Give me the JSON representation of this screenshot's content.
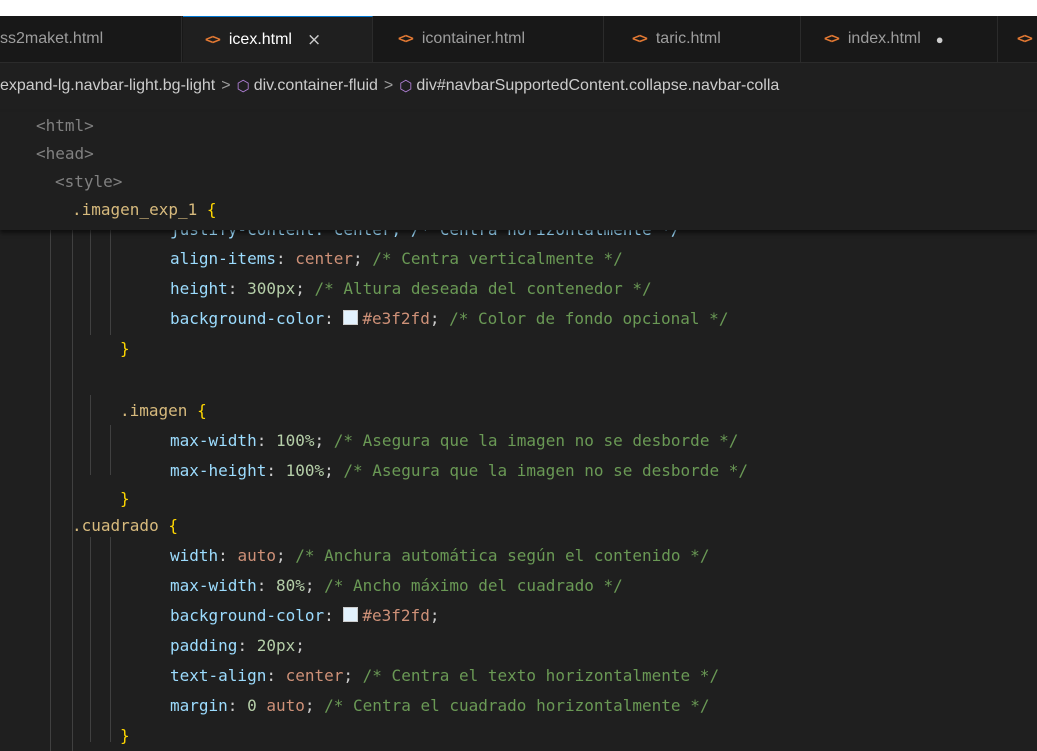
{
  "tabs": [
    {
      "label": "ss2maket.html",
      "icon": "<>",
      "active": false
    },
    {
      "label": "icex.html",
      "icon": "<>",
      "active": true,
      "close": "×"
    },
    {
      "label": "icontainer.html",
      "icon": "<>",
      "active": false
    },
    {
      "label": "taric.html",
      "icon": "<>",
      "active": false
    },
    {
      "label": "index.html",
      "icon": "<>",
      "active": false,
      "dirty": "●"
    },
    {
      "label": "",
      "icon": "<>",
      "active": false
    }
  ],
  "breadcrumb": {
    "part1": "expand-lg.navbar-light.bg-light",
    "separator": ">",
    "part2": "div.container-fluid",
    "part3": "div#navbarSupportedContent.collapse.navbar-colla"
  },
  "sticky": {
    "html_open": "<html>",
    "head_open": "<head>",
    "style_open": "<style>",
    "selector1": ".imagen_exp_1",
    "brace_open": "{"
  },
  "code": {
    "line_partial": "justify-content: center; /* Centra horizontalmente */",
    "l1_prop": "align-items",
    "l1_val": "center",
    "l1_comment": "/* Centra verticalmente */",
    "l2_prop": "height",
    "l2_val": "300px",
    "l2_comment": "/* Altura deseada del contenedor */",
    "l3_prop": "background-color",
    "l3_val": "#e3f2fd",
    "l3_comment": "/* Color de fondo opcional */",
    "close1": "}",
    "sel2": ".imagen",
    "open2": "{",
    "l4_prop": "max-width",
    "l4_val": "100%",
    "l4_comment": "/* Asegura que la imagen no se desborde */",
    "l5_prop": "max-height",
    "l5_val": "100%",
    "l5_comment": "/* Asegura que la imagen no se desborde */",
    "close2": "}",
    "sel3": ".cuadrado",
    "open3": "{",
    "l6_prop": "width",
    "l6_val": "auto",
    "l6_comment": "/* Anchura automática según el contenido */",
    "l7_prop": "max-width",
    "l7_val": "80%",
    "l7_comment": "/* Ancho máximo del cuadrado */",
    "l8_prop": "background-color",
    "l8_val": "#e3f2fd",
    "l9_prop": "padding",
    "l9_val": "20px",
    "l10_prop": "text-align",
    "l10_val": "center",
    "l10_comment": "/* Centra el texto horizontalmente */",
    "l11_prop": "margin",
    "l11_val0": "0",
    "l11_val1": "auto",
    "l11_comment": "/* Centra el cuadrado horizontalmente */",
    "close3": "}"
  },
  "colors": {
    "background": "#1f1f1f",
    "tab_accent": "#0078d4",
    "swatch": "#e3f2fd"
  }
}
